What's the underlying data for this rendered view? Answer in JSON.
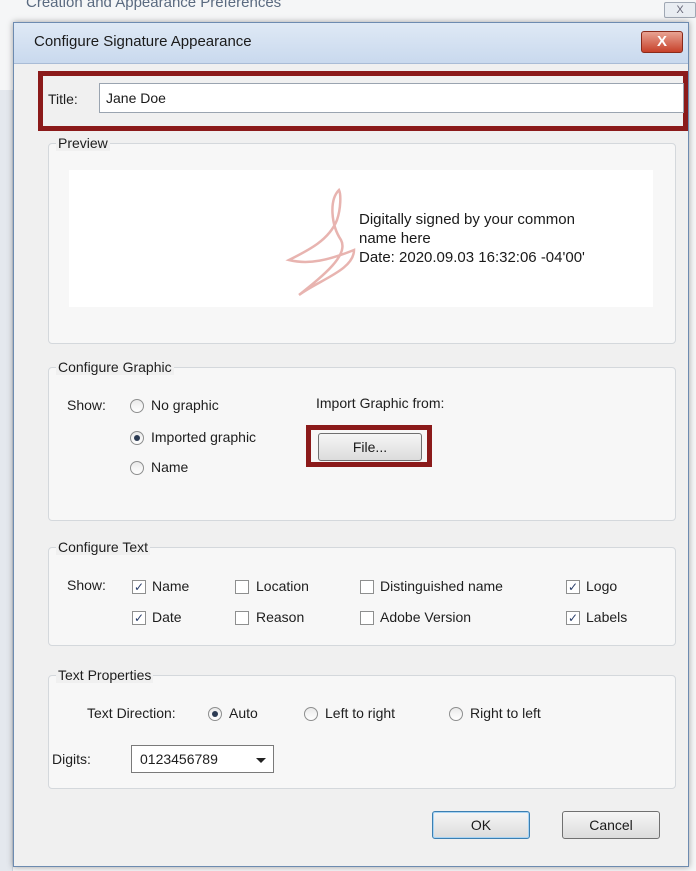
{
  "background_window": {
    "title": "Creation and Appearance Preferences",
    "close_label": "X"
  },
  "dialog": {
    "title": "Configure Signature Appearance",
    "close_label": "X"
  },
  "title_field": {
    "label": "Title:",
    "value": "Jane Doe"
  },
  "preview": {
    "legend": "Preview",
    "line1": "Digitally signed by your common",
    "line2": "name here",
    "line3": "Date: 2020.09.03 16:32:06 -04'00'"
  },
  "configure_graphic": {
    "legend": "Configure Graphic",
    "show_label": "Show:",
    "options": [
      {
        "label": "No graphic",
        "selected": false
      },
      {
        "label": "Imported graphic",
        "selected": true
      },
      {
        "label": "Name",
        "selected": false
      }
    ],
    "import_label": "Import Graphic from:",
    "file_button": "File..."
  },
  "configure_text": {
    "legend": "Configure Text",
    "show_label": "Show:",
    "items": [
      {
        "label": "Name",
        "checked": true
      },
      {
        "label": "Location",
        "checked": false
      },
      {
        "label": "Distinguished name",
        "checked": false
      },
      {
        "label": "Logo",
        "checked": true
      },
      {
        "label": "Date",
        "checked": true
      },
      {
        "label": "Reason",
        "checked": false
      },
      {
        "label": "Adobe Version",
        "checked": false
      },
      {
        "label": "Labels",
        "checked": true
      }
    ]
  },
  "text_properties": {
    "legend": "Text Properties",
    "direction_label": "Text Direction:",
    "directions": [
      {
        "label": "Auto",
        "selected": true
      },
      {
        "label": "Left to right",
        "selected": false
      },
      {
        "label": "Right to left",
        "selected": false
      }
    ],
    "digits_label": "Digits:",
    "digits_value": "0123456789"
  },
  "buttons": {
    "ok": "OK",
    "cancel": "Cancel"
  },
  "colors": {
    "highlight": "#8b1a1a",
    "close_button": "#c7412a",
    "acrobat_logo": "#e8b4b0"
  }
}
